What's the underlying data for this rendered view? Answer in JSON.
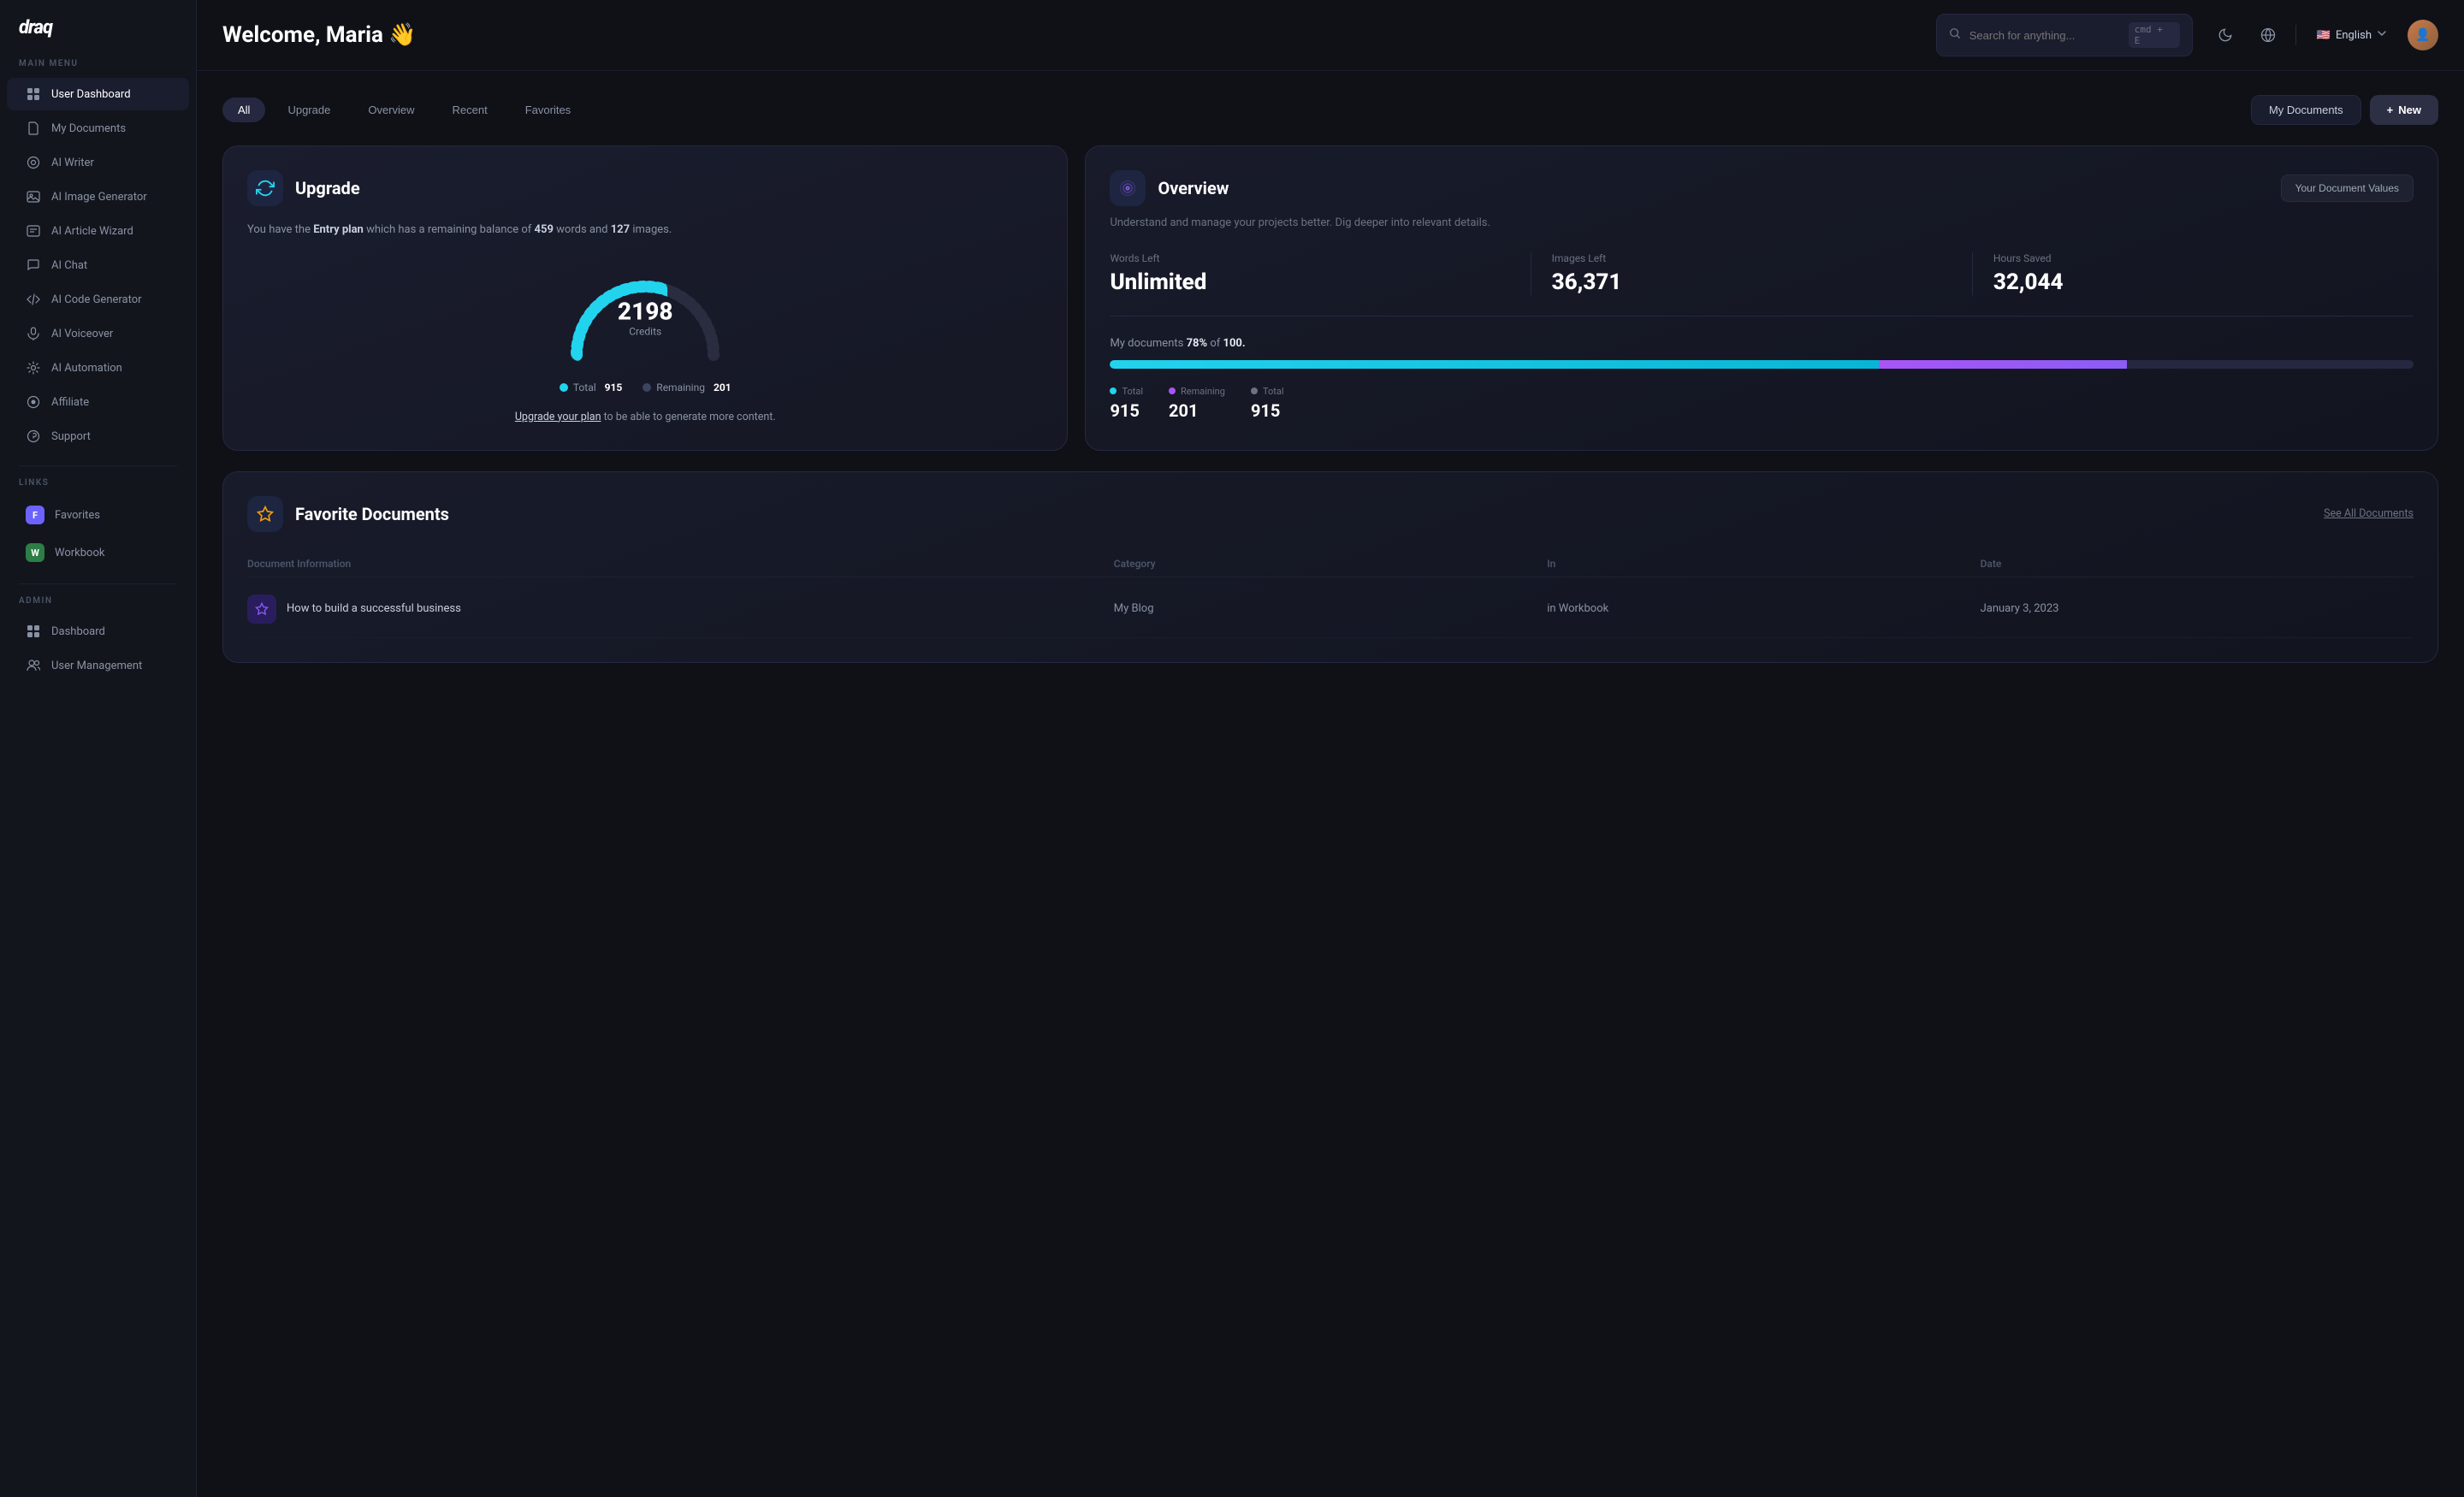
{
  "app": {
    "logo": "draq",
    "welcome": "Welcome, Maria 👋",
    "search_placeholder": "Search for anything...",
    "search_shortcut": "cmd + E"
  },
  "header": {
    "lang_flag": "🇺🇸",
    "lang_label": "English",
    "my_documents_btn": "My Documents",
    "new_btn": "New"
  },
  "sidebar": {
    "main_menu_label": "MAIN MENU",
    "main_items": [
      {
        "id": "user-dashboard",
        "label": "User Dashboard",
        "icon": "⊞",
        "active": true
      },
      {
        "id": "my-documents",
        "label": "My Documents",
        "icon": "◎"
      },
      {
        "id": "ai-writer",
        "label": "AI Writer",
        "icon": "◎"
      },
      {
        "id": "ai-image-generator",
        "label": "AI Image Generator",
        "icon": "◎"
      },
      {
        "id": "ai-article-wizard",
        "label": "AI Article Wizard",
        "icon": "◎"
      },
      {
        "id": "ai-chat",
        "label": "AI Chat",
        "icon": "◎"
      },
      {
        "id": "ai-code-generator",
        "label": "AI Code Generator",
        "icon": "◎"
      },
      {
        "id": "ai-voiceover",
        "label": "AI Voiceover",
        "icon": "◎"
      },
      {
        "id": "ai-automation",
        "label": "AI Automation",
        "icon": "⚙"
      },
      {
        "id": "affiliate",
        "label": "Affiliate",
        "icon": "◎"
      },
      {
        "id": "support",
        "label": "Support",
        "icon": "⚙"
      }
    ],
    "links_label": "LINKS",
    "link_items": [
      {
        "id": "favorites",
        "label": "Favorites",
        "badge": "F",
        "badge_class": "badge-f"
      },
      {
        "id": "workbook",
        "label": "Workbook",
        "badge": "W",
        "badge_class": "badge-w"
      }
    ],
    "admin_label": "ADMIN",
    "admin_items": [
      {
        "id": "dashboard",
        "label": "Dashboard",
        "icon": "⊞"
      },
      {
        "id": "user-management",
        "label": "User Management",
        "icon": "◎"
      }
    ]
  },
  "filters": {
    "tabs": [
      {
        "id": "all",
        "label": "All",
        "active": true
      },
      {
        "id": "upgrade",
        "label": "Upgrade"
      },
      {
        "id": "overview",
        "label": "Overview"
      },
      {
        "id": "recent",
        "label": "Recent"
      },
      {
        "id": "favorites",
        "label": "Favorites"
      }
    ]
  },
  "upgrade_card": {
    "icon": "♻",
    "title": "Upgrade",
    "description_pre": "You have the ",
    "plan": "Entry plan",
    "description_mid": " which has a remaining balance of ",
    "words": "459",
    "description_words": " words and ",
    "images": "127",
    "description_post": " images.",
    "credits_value": "2198",
    "credits_label": "Credits",
    "legend_total_label": "Total",
    "legend_total_value": "915",
    "legend_remaining_label": "Remaining",
    "legend_remaining_value": "201",
    "upgrade_link_text": "Upgrade your plan",
    "upgrade_suffix": " to be able to generate more content."
  },
  "overview_card": {
    "icon": "✦",
    "title": "Overview",
    "subtitle": "Understand and manage your projects better. Dig deeper into relevant details.",
    "doc_values_btn": "Your Document Values",
    "stats": [
      {
        "label": "Words Left",
        "value": "Unlimited"
      },
      {
        "label": "Images Left",
        "value": "36,371"
      },
      {
        "label": "Hours Saved",
        "value": "32,044"
      }
    ],
    "docs_progress_label": "My documents",
    "docs_progress_pct": "78%",
    "docs_progress_of": "of",
    "docs_progress_total": "100.",
    "progress_cyan_pct": 59,
    "progress_purple_pct": 19,
    "legend": [
      {
        "label": "Total",
        "value": "915",
        "color": "#22d3ee"
      },
      {
        "label": "Remaining",
        "value": "201",
        "color": "#a855f7"
      },
      {
        "label": "Total",
        "value": "915",
        "color": "#6b7280"
      }
    ]
  },
  "favorite_docs": {
    "icon": "✦",
    "title": "Favorite Documents",
    "see_all": "See All Documents",
    "columns": [
      "Document Information",
      "Category",
      "In",
      "Date"
    ],
    "rows": [
      {
        "icon": "✦",
        "name": "How to build a successful business",
        "category": "My Blog",
        "in": "in Workbook",
        "date": "January 3, 2023"
      }
    ]
  }
}
